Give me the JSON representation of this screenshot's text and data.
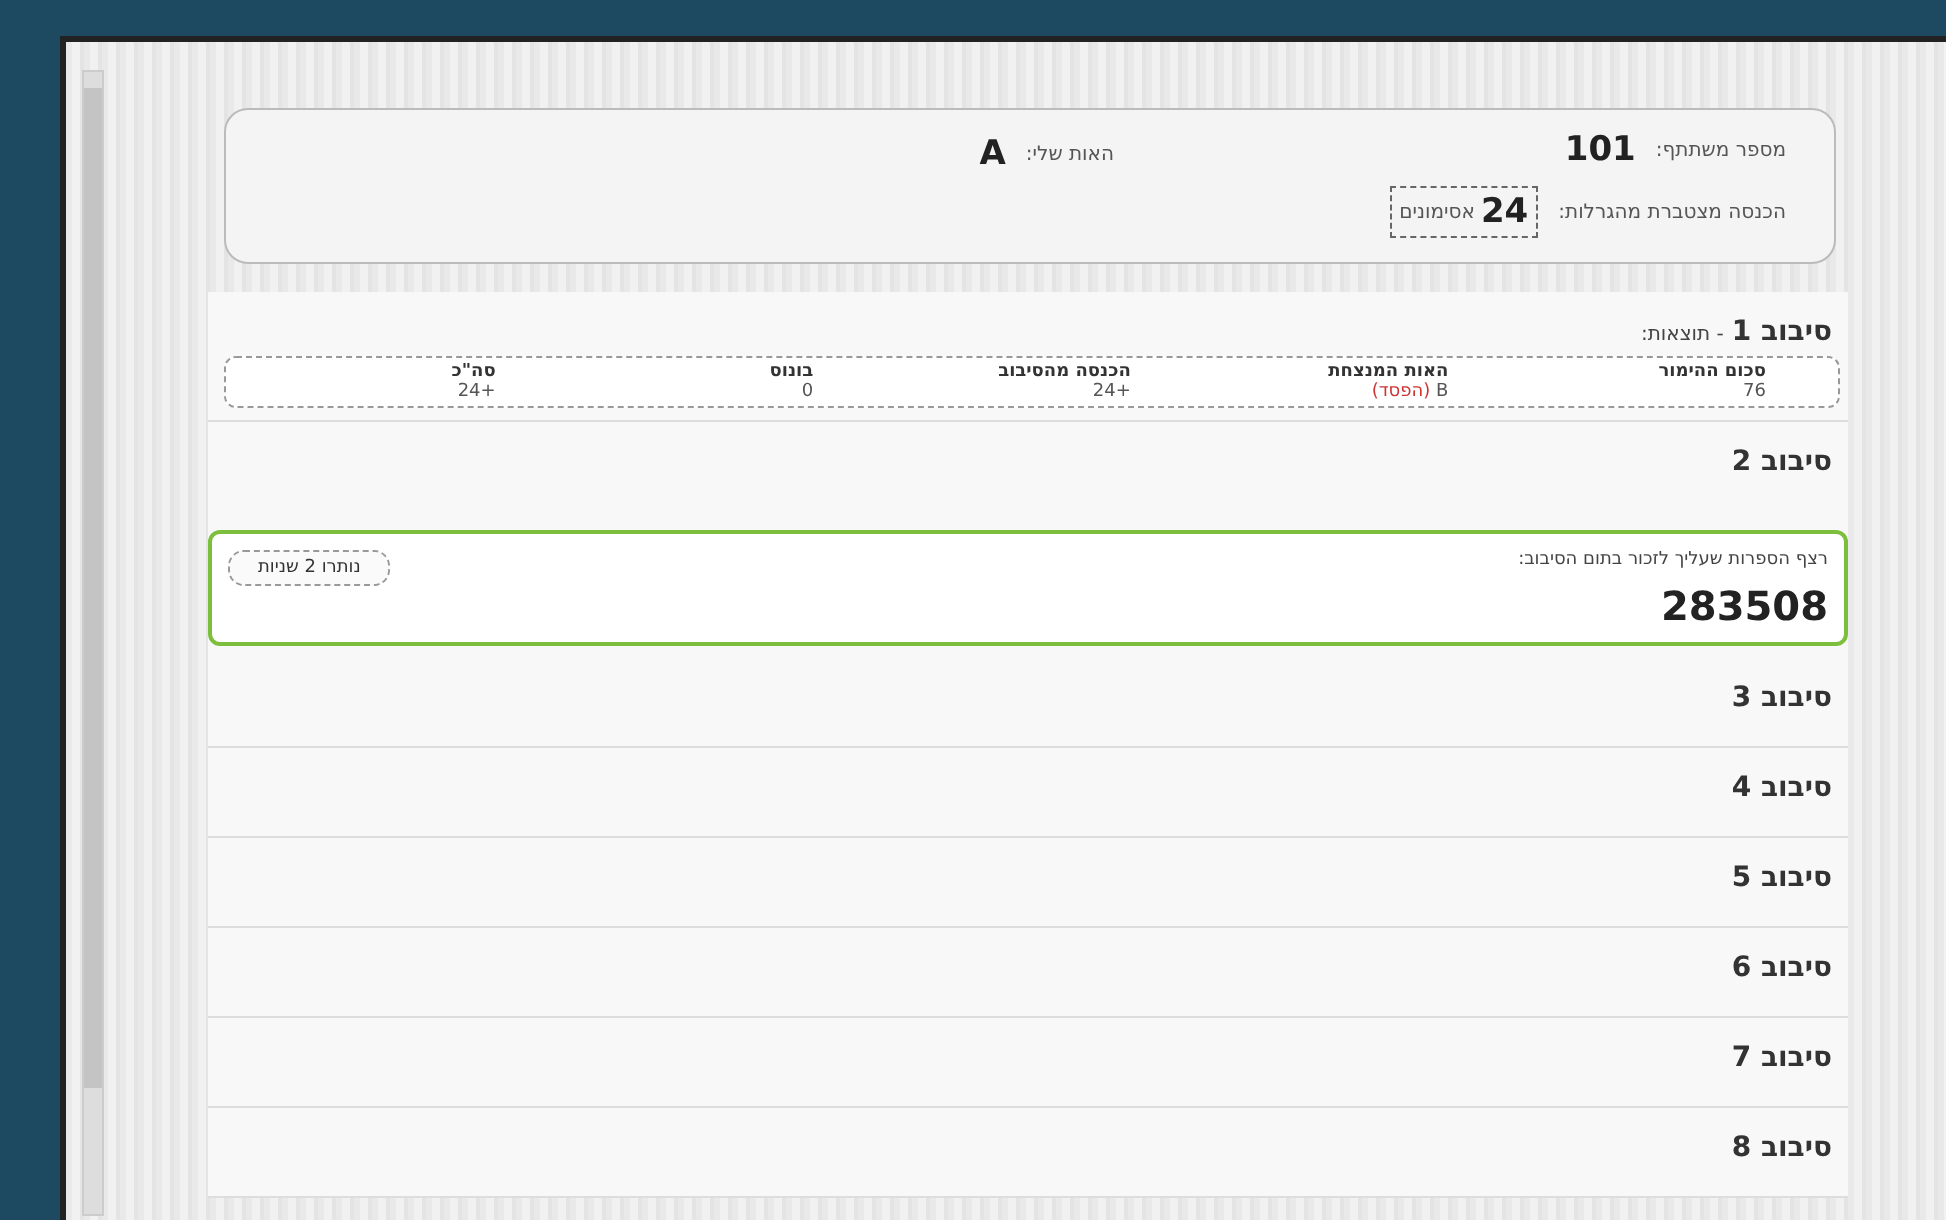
{
  "participant": {
    "label": "מספר משתתף:",
    "value": "101"
  },
  "earnings": {
    "label": "הכנסה מצטברת מהגרלות:",
    "value": "24",
    "unit": "אסימונים"
  },
  "my_letter": {
    "label": "האות שלי:",
    "value": "A"
  },
  "rounds": [
    {
      "title": "סיבוב 1",
      "subtitle": "- תוצאות:",
      "results": {
        "columns": [
          "סכום ההימור",
          "האות המנצחת",
          "הכנסה מהסיבוב",
          "בונוס",
          "סה\"כ"
        ],
        "cells": [
          {
            "text": "76"
          },
          {
            "text": "B",
            "note": "(הפסד)"
          },
          {
            "text": "+24"
          },
          {
            "text": "0"
          },
          {
            "text": "+24"
          }
        ]
      }
    },
    {
      "title": "סיבוב 2",
      "task": {
        "prompt": "רצף הספרות שעליך לזכור בתום הסיבוב:",
        "number": "283508",
        "timer": "נותרו 2 שניות"
      }
    },
    {
      "title": "סיבוב 3"
    },
    {
      "title": "סיבוב 4"
    },
    {
      "title": "סיבוב 5"
    },
    {
      "title": "סיבוב 6"
    },
    {
      "title": "סיבוב 7"
    },
    {
      "title": "סיבוב 8"
    }
  ]
}
